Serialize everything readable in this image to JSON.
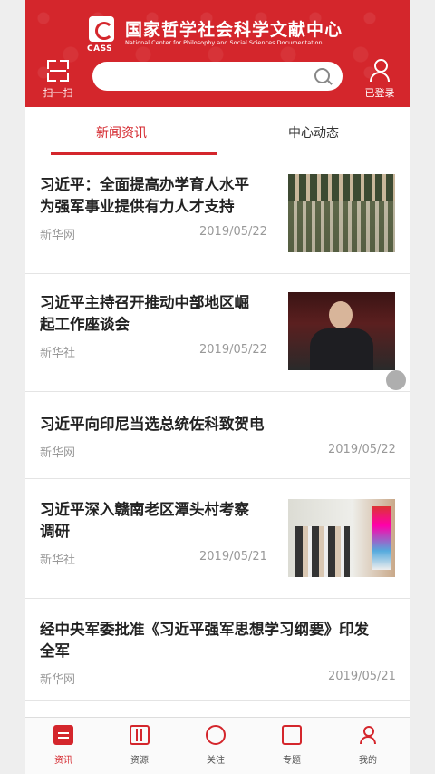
{
  "header": {
    "logo_cn": "国家哲学社会科学文献中心",
    "logo_en": "National Center for Philosophy and Social Sciences Documentation",
    "logo_mark": "CASS",
    "scan_label": "扫一扫",
    "search_placeholder": "",
    "login_label": "已登录",
    "brand_color": "#d4262c"
  },
  "tabs": [
    {
      "label": "新闻资讯",
      "active": true
    },
    {
      "label": "中心动态",
      "active": false
    }
  ],
  "news": [
    {
      "title_line1": "习近平：全面提高办学育人水平",
      "title_line2": "为强军事业提供有力人才支持",
      "source": "新华网",
      "date": "2019/05/22"
    },
    {
      "title_line1": "习近平主持召开推动中部地区崛",
      "title_line2": "起工作座谈会",
      "source": "新华社",
      "date": "2019/05/22"
    },
    {
      "title_line1": "习近平向印尼当选总统佐科致贺电",
      "title_line2": "",
      "source": "新华网",
      "date": "2019/05/22"
    },
    {
      "title_line1": "习近平深入赣南老区潭头村考察",
      "title_line2": "调研",
      "source": "新华社",
      "date": "2019/05/21"
    },
    {
      "title_line1": "经中央军委批准《习近平强军思想学习纲要》印发",
      "title_line2": "全军",
      "source": "新华网",
      "date": "2019/05/21"
    }
  ],
  "bottom_nav": [
    {
      "label": "资讯",
      "icon": "news-icon",
      "active": true
    },
    {
      "label": "资源",
      "icon": "resource-icon",
      "active": false
    },
    {
      "label": "关注",
      "icon": "follow-icon",
      "active": false
    },
    {
      "label": "专题",
      "icon": "topic-icon",
      "active": false
    },
    {
      "label": "我的",
      "icon": "user-icon",
      "active": false
    }
  ]
}
